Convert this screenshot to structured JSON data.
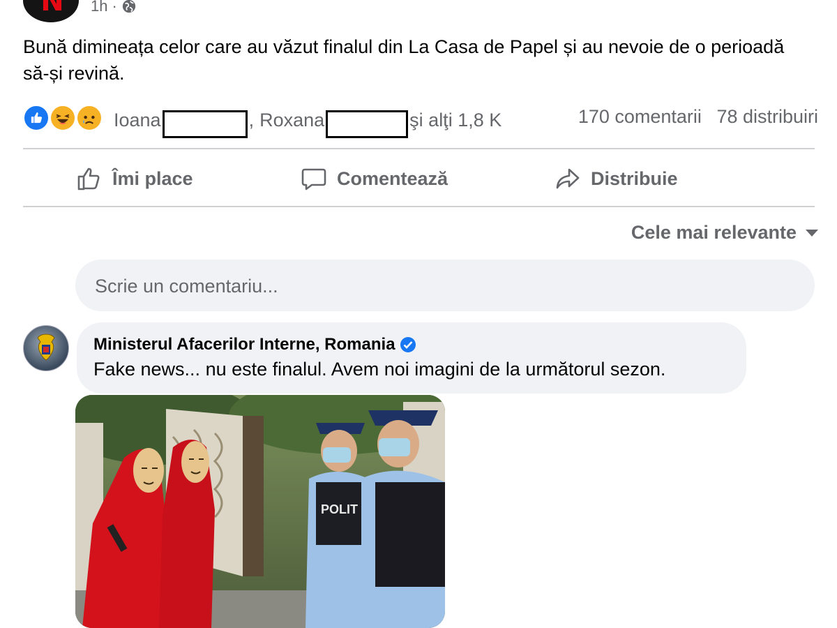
{
  "post": {
    "time": "1h",
    "separator": "·",
    "text": "Bună dimineața celor care au văzut finalul din La Casa de Papel și au nevoie de o perioadă să-și revină."
  },
  "reactions": {
    "icons": [
      "like-icon",
      "haha-icon",
      "sad-icon"
    ],
    "name1": "Ioana",
    "comma": ",",
    "name2": "Roxana",
    "others": "şi alţi 1,8 K",
    "comments_count": "170 comentarii",
    "shares_count": "78 distribuiri"
  },
  "actions": {
    "like": "Îmi place",
    "comment": "Comentează",
    "share": "Distribuie"
  },
  "sort": {
    "label": "Cele mai relevante"
  },
  "comment_input": {
    "placeholder": "Scrie un comentariu...",
    "icons": [
      "emoji-icon",
      "camera-icon",
      "gif-icon",
      "sticker-icon"
    ]
  },
  "reply": {
    "author": "Ministerul Afacerilor Interne, Romania",
    "text": "Fake news... nu este finalul. Avem noi imagini de la următorul sezon."
  },
  "colors": {
    "accent": "#1877f2",
    "muted_text": "#65676b",
    "bubble_bg": "#f0f2f5",
    "divider": "#ced0d4"
  }
}
